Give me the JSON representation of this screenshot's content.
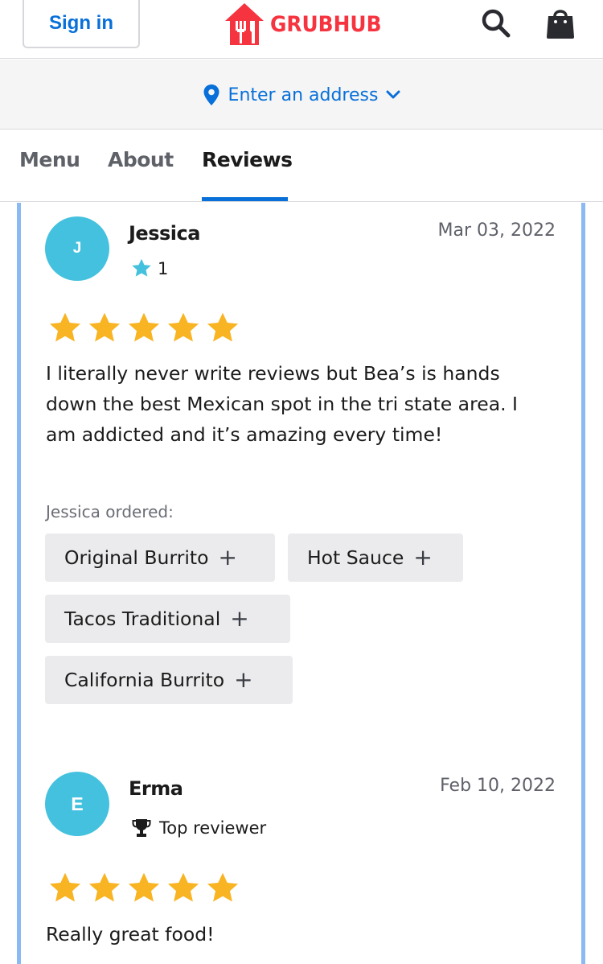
{
  "header": {
    "signin_label": "Sign in",
    "logo_text": "GRUBHUB",
    "search_icon": "search-icon",
    "bag_icon": "shopping-bag-icon"
  },
  "address_bar": {
    "placeholder": "Enter an address",
    "icon": "location-pin-icon"
  },
  "tabs": [
    {
      "label": "Menu",
      "active": false
    },
    {
      "label": "About",
      "active": false
    },
    {
      "label": "Reviews",
      "active": true
    }
  ],
  "reviews": [
    {
      "initial": "J",
      "name": "Jessica",
      "date": "Mar 03, 2022",
      "reviewer_count": "1",
      "rating": 5,
      "text": "I literally never write reviews but Bea’s is hands down the best Mexican spot in the tri state area. I am addicted and it’s amazing every time!",
      "ordered_label": "Jessica ordered:",
      "ordered_items": [
        "Original Burrito",
        "Hot Sauce",
        "Tacos Traditional",
        "California Burrito"
      ]
    },
    {
      "initial": "E",
      "name": "Erma",
      "date": "Feb 10, 2022",
      "badge": "Top reviewer",
      "rating": 5,
      "text": "Really great food!"
    }
  ],
  "colors": {
    "brand_red": "#f63440",
    "link_blue": "#0870d8",
    "avatar": "#44c1de",
    "star": "#f8b422",
    "panel_border": "#8ab9f3"
  }
}
